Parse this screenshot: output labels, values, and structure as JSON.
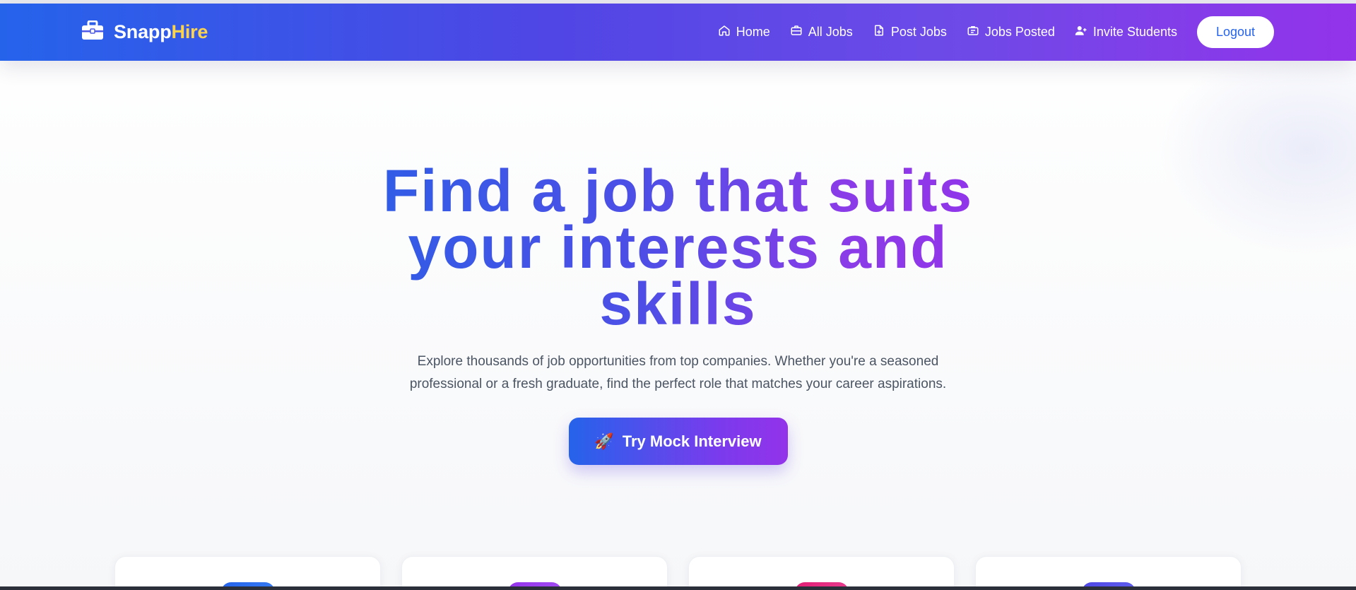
{
  "brand": {
    "name_primary": "Snapp",
    "name_accent": "Hire",
    "icon": "briefcase-icon"
  },
  "nav": {
    "items": [
      {
        "label": "Home",
        "icon": "home-icon"
      },
      {
        "label": "All Jobs",
        "icon": "briefcase-icon"
      },
      {
        "label": "Post Jobs",
        "icon": "file-plus-icon"
      },
      {
        "label": "Jobs Posted",
        "icon": "briefcase-list-icon"
      },
      {
        "label": "Invite Students",
        "icon": "user-plus-icon"
      }
    ],
    "logout_label": "Logout"
  },
  "hero": {
    "headline": "Find a job that suits your interests and skills",
    "subtext": "Explore thousands of job opportunities from top companies. Whether you're a seasoned professional or a fresh graduate, find the perfect role that matches your career aspirations.",
    "cta_emoji": "🚀",
    "cta_label": "Try Mock Interview"
  },
  "cards": [
    {
      "icon_color": "#2563eb"
    },
    {
      "icon_color": "#9333ea"
    },
    {
      "icon_color": "#e11d74"
    },
    {
      "icon_color": "#4f46e5"
    }
  ],
  "colors": {
    "nav_gradient_start": "#2563eb",
    "nav_gradient_end": "#9333ea",
    "brand_accent": "#fcd34d",
    "logout_text": "#2563eb"
  }
}
